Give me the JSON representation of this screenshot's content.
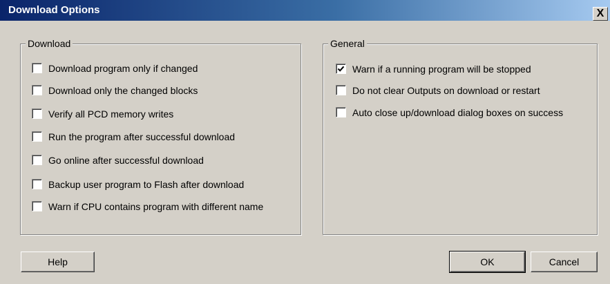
{
  "window": {
    "title": "Download Options",
    "close_label": "X"
  },
  "download_group": {
    "label": "Download",
    "options": [
      {
        "label": "Download program only if changed",
        "checked": false
      },
      {
        "label": "Download only the changed blocks",
        "checked": false
      },
      {
        "label": "Verify all PCD memory writes",
        "checked": false
      },
      {
        "label": "Run the program after successful download",
        "checked": false
      },
      {
        "label": "Go online after successful download",
        "checked": false
      },
      {
        "label": "Backup user program to Flash after download",
        "checked": false
      },
      {
        "label": "Warn if CPU contains program with different name",
        "checked": false
      }
    ]
  },
  "general_group": {
    "label": "General",
    "options": [
      {
        "label": "Warn if a running program will be stopped",
        "checked": true
      },
      {
        "label": "Do not clear Outputs on download or restart",
        "checked": false
      },
      {
        "label": "Auto close up/download dialog boxes on success",
        "checked": false
      }
    ]
  },
  "buttons": {
    "help": "Help",
    "ok": "OK",
    "cancel": "Cancel"
  }
}
